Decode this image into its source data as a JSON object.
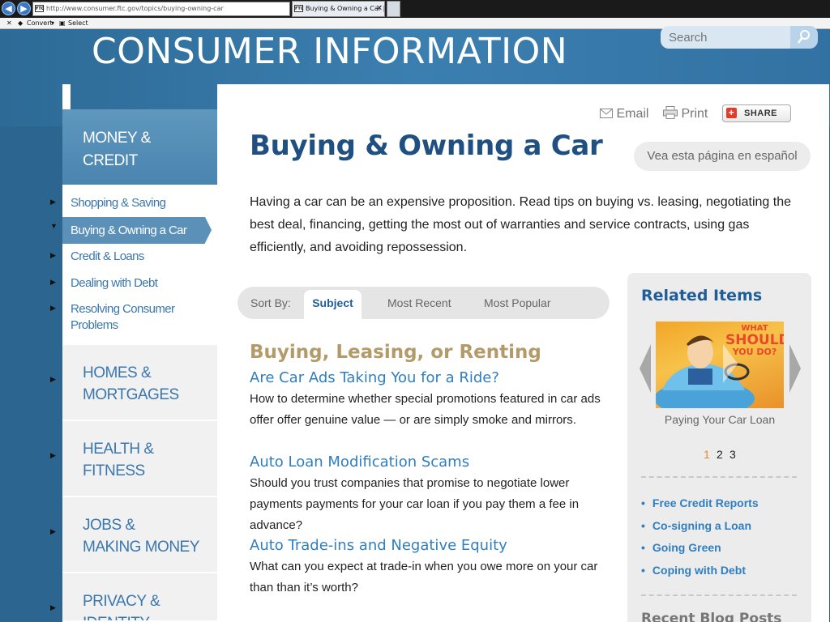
{
  "browser": {
    "url": "http://www.consumer.ftc.gov/topics/buying-owning-car",
    "addr_controls": "⌕ ▾ ↻ ✖",
    "tab_title": "Buying & Owning a Car | C...",
    "favicon_text": "FTC",
    "toolbar": {
      "convert": "Convert",
      "select": "Select"
    }
  },
  "header": {
    "site_title": "CONSUMER INFORMATION",
    "search_placeholder": "Search"
  },
  "sidebar": {
    "active_category": [
      "MONEY &",
      "CREDIT"
    ],
    "links": [
      {
        "label": "Shopping & Saving"
      },
      {
        "label": "Buying & Owning a Car"
      },
      {
        "label": "Credit & Loans"
      },
      {
        "label": "Dealing with Debt"
      },
      {
        "label": "Resolving Consumer Problems"
      }
    ],
    "categories": [
      {
        "line1": "HOMES &",
        "line2": "MORTGAGES"
      },
      {
        "line1": "HEALTH &",
        "line2": "FITNESS"
      },
      {
        "line1": "JOBS &",
        "line2": "MAKING MONEY"
      },
      {
        "line1": "PRIVACY &",
        "line2": "IDENTITY"
      }
    ]
  },
  "actions": {
    "email": "Email",
    "print": "Print",
    "share": "SHARE"
  },
  "main": {
    "title": "Buying & Owning a Car",
    "spanish_link": "Vea esta página en español",
    "intro": "Having a car can be an expensive proposition. Read tips on buying vs. leasing, negotiating the best deal, financing, getting the most out of warranties and service contracts, using gas efficiently, and avoiding repossession.",
    "sort": {
      "label": "Sort By:",
      "tabs": [
        "Subject",
        "Most Recent",
        "Most Popular"
      ],
      "active": "Subject"
    },
    "section_title": "Buying, Leasing, or Renting",
    "articles": [
      {
        "title": "Are Car Ads Taking You for a Ride?",
        "desc": "How to determine whether special promotions featured in car ads offer offer genuine value — or are simply smoke and mirrors."
      },
      {
        "title": "Auto Loan Modification Scams",
        "desc": "Should you trust companies that promise to negotiate lower payments payments for your car loan if you pay them a fee in advance?"
      },
      {
        "title": "Auto Trade-ins and Negative Equity",
        "desc": "What can you expect at trade-in when you owe more on your car than than it’s worth?"
      }
    ]
  },
  "related": {
    "title": "Related Items",
    "image_text": [
      "WHAT",
      "SHOULD",
      "YOU DO?"
    ],
    "caption": "Paying Your Car Loan",
    "pages": [
      "1",
      "2",
      "3"
    ],
    "current_page": "1",
    "links": [
      "Free Credit Reports",
      "Co-signing a Loan",
      "Going Green",
      "Coping with Debt"
    ],
    "blog_title": "Recent Blog Posts"
  },
  "colors": {
    "header_blue": "#3b7fb0",
    "title_blue": "#1f5081",
    "link_blue": "#2f7ec0",
    "section_tan": "#b39a69",
    "page_orange": "#e0892e"
  }
}
